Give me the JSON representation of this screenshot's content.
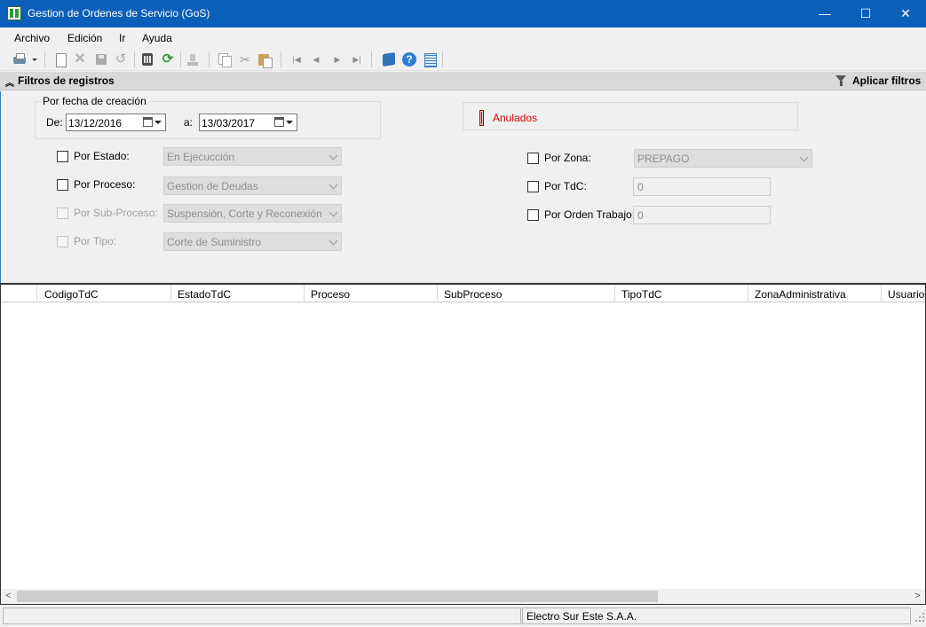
{
  "window": {
    "title": "Gestion de Ordenes de Servicio (GoS)",
    "minimize": "—",
    "maximize": "☐",
    "close": "✕"
  },
  "menu": [
    "Archivo",
    "Edición",
    "Ir",
    "Ayuda"
  ],
  "toolbar": {
    "icons": [
      "printer-icon",
      "new-document-icon",
      "delete-icon",
      "save-icon",
      "undo-icon",
      "calculator-icon",
      "refresh-icon",
      "export-icon",
      "copy-icon",
      "cut-icon",
      "paste-icon",
      "first-record-icon",
      "previous-record-icon",
      "next-record-icon",
      "last-record-icon",
      "manual-icon",
      "help-icon",
      "spreadsheet-icon"
    ]
  },
  "filters": {
    "section_title": "Filtros de registros",
    "apply_label": "Aplicar filtros",
    "by_date": {
      "legend": "Por fecha de creación",
      "from_label": "De:",
      "from_value": "13/12/2016",
      "to_label": "a:",
      "to_value": "13/03/2017"
    },
    "anulados_label": "Anulados",
    "left": [
      {
        "label": "Por Estado:",
        "value": "En Ejecucción",
        "checked": false,
        "enabled": true
      },
      {
        "label": "Por Proceso:",
        "value": "Gestion de Deudas",
        "checked": false,
        "enabled": true
      },
      {
        "label": "Por Sub-Proceso:",
        "value": "Suspensión, Corte y Reconexión",
        "checked": false,
        "enabled": false
      },
      {
        "label": "Por Tipo:",
        "value": "Corte de Suministro",
        "checked": false,
        "enabled": false
      }
    ],
    "right": [
      {
        "label": "Por Zona:",
        "value": "PREPAGO",
        "checked": false
      },
      {
        "label": "Por TdC:",
        "value": "0",
        "checked": false
      },
      {
        "label": "Por Orden Trabajo:",
        "value": "0",
        "checked": false
      }
    ]
  },
  "grid": {
    "columns": [
      "CodigoTdC",
      "EstadoTdC",
      "Proceso",
      "SubProceso",
      "TipoTdC",
      "ZonaAdministrativa",
      "UsuarioC"
    ],
    "rows": []
  },
  "status": {
    "left": "",
    "company": "Electro Sur Este S.A.A."
  },
  "colors": {
    "titlebar": "#0b5fb8",
    "anulados": "#d40000"
  }
}
